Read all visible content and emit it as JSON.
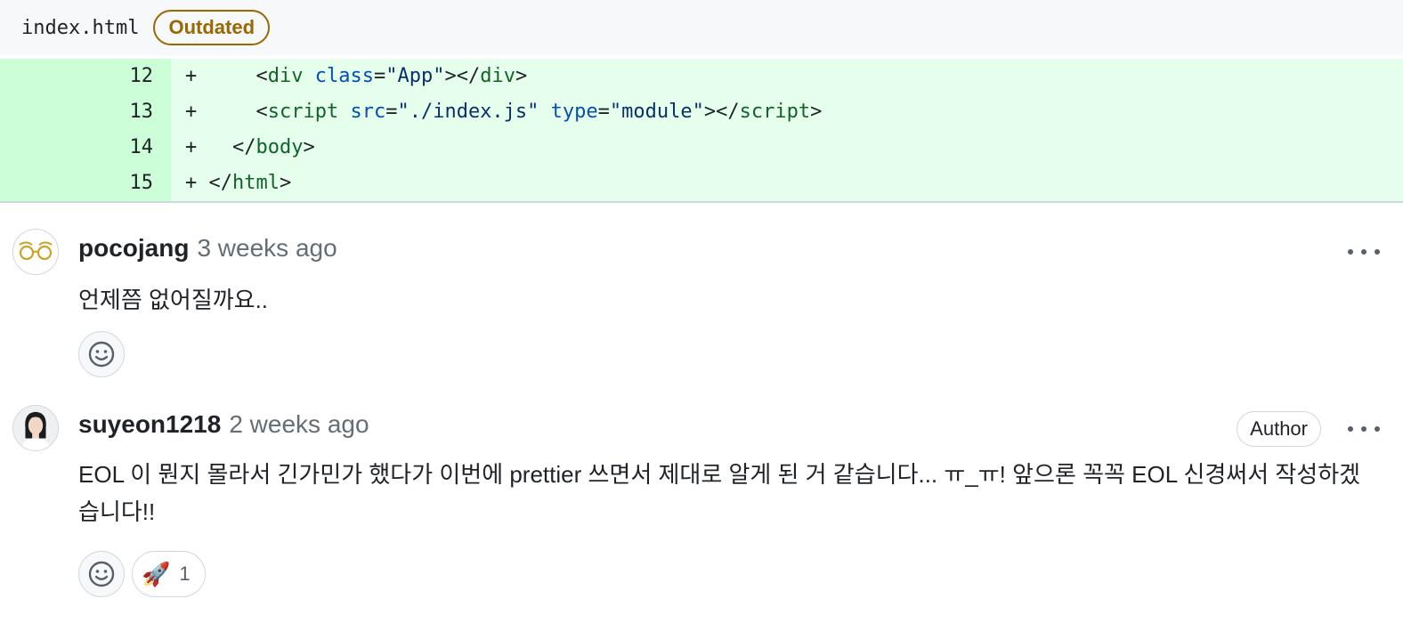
{
  "file": {
    "name": "index.html",
    "badge": "Outdated"
  },
  "diff": {
    "lines": [
      {
        "num": "12",
        "sign": "+",
        "indent": "    ",
        "open": "<",
        "tag": "div",
        "attr1": "class",
        "eq1": "=",
        "val1": "\"App\"",
        "close1": "></",
        "endtag": "div",
        "end": ">"
      },
      {
        "num": "13",
        "sign": "+",
        "indent": "    ",
        "open": "<",
        "tag": "script",
        "attr1": "src",
        "eq1": "=",
        "val1": "\"./index.js\"",
        "attr2": "type",
        "eq2": "=",
        "val2": "\"module\"",
        "close1": "></",
        "endtag": "script",
        "end": ">"
      },
      {
        "num": "14",
        "sign": "+",
        "indent": "  ",
        "open": "</",
        "tag": "body",
        "end": ">"
      },
      {
        "num": "15",
        "sign": "+",
        "indent": "",
        "open": "</",
        "tag": "html",
        "end": ">"
      }
    ]
  },
  "comments": [
    {
      "author": "pocojang",
      "time": "3 weeks ago",
      "body": "언제쯤 없어질까요..",
      "avatar_icon": "glasses-icon"
    },
    {
      "author": "suyeon1218",
      "time": "2 weeks ago",
      "badge": "Author",
      "body": "EOL 이 뭔지 몰라서 긴가민가 했다가 이번에 prettier 쓰면서 제대로 알게 된 거 같습니다... ㅠ_ㅠ! 앞으론 꼭꼭 EOL 신경써서 작성하겠습니다!!",
      "reaction": {
        "emoji": "🚀",
        "count": "1"
      },
      "avatar_icon": "person-avatar"
    }
  ],
  "colors": {
    "added_bg": "#e6ffec",
    "added_num_bg": "#ccffd8",
    "badge": "#9a6700"
  }
}
